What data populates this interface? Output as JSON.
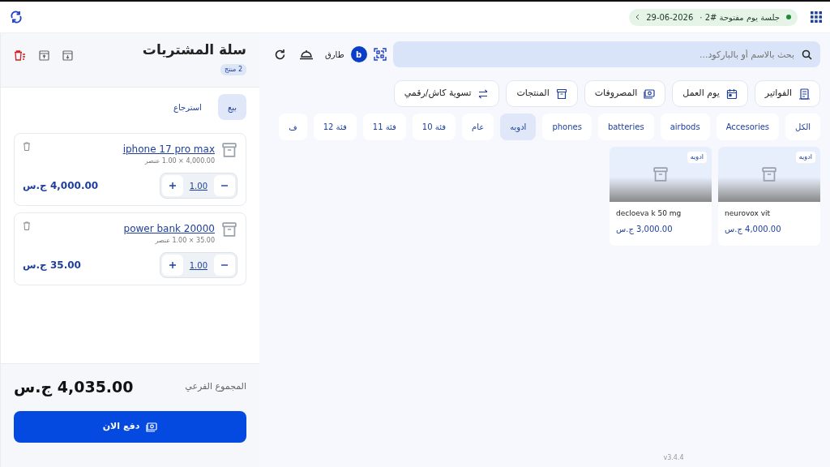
{
  "top_bar": {
    "session": "جلسة يوم مفتوحة #2 ·",
    "date": "29-06-2026",
    "session_open": true
  },
  "search": {
    "placeholder": "بحث بالاسم أو بالباركود..."
  },
  "user": {
    "initial": "b",
    "name": "طارق"
  },
  "actions": [
    {
      "label": "الفواتير",
      "kind": "invoice"
    },
    {
      "label": "يوم العمل",
      "kind": "calendar"
    },
    {
      "label": "المصروفات",
      "kind": "money"
    },
    {
      "label": "المنتجات",
      "kind": "box"
    },
    {
      "label": "تسوية كاش/رقمي",
      "kind": "swap"
    }
  ],
  "categories": [
    {
      "label": "الكل",
      "selected": false
    },
    {
      "label": "Accesories",
      "selected": false
    },
    {
      "label": "airbods",
      "selected": false
    },
    {
      "label": "batteries",
      "selected": false
    },
    {
      "label": "phones",
      "selected": false
    },
    {
      "label": "ادويه",
      "selected": true
    },
    {
      "label": "عام",
      "selected": false
    },
    {
      "label": "فئة 10",
      "selected": false
    },
    {
      "label": "فئة 11",
      "selected": false
    },
    {
      "label": "فئة 12",
      "selected": false
    },
    {
      "label": "ف",
      "selected": false
    }
  ],
  "products": [
    {
      "tag": "ادويه",
      "name": "neurovox vit",
      "price": "4,000.00 ج.س"
    },
    {
      "tag": "ادويه",
      "name": "decloeva k 50 mg",
      "price": "3,000.00 ج.س"
    }
  ],
  "version": "v3.4.4",
  "cart": {
    "title": "سلة المشتريات",
    "count": "2 منتج",
    "modes": [
      {
        "label": "بيع",
        "selected": true
      },
      {
        "label": "استرجاع",
        "selected": false
      }
    ],
    "items": [
      {
        "name": "iphone 17 pro max",
        "detail": "4,000.00 × 1.00 عنصر",
        "qty": "1.00",
        "total": "4,000.00 ج.س"
      },
      {
        "name": "power bank 20000",
        "detail": "35.00 × 1.00 عنصر",
        "qty": "1.00",
        "total": "35.00 ج.س"
      }
    ],
    "subtotal_label": "المجموع الفرعي",
    "subtotal": "4,035.00 ج.س",
    "pay": "دفع الان"
  }
}
